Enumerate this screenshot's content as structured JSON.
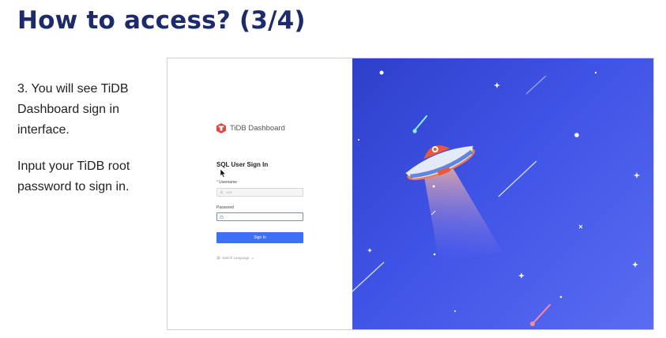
{
  "slide": {
    "title": "How to access? (3/4)",
    "step_text": "3. You will see TiDB Dashboard sign in interface.",
    "instruction_text": "Input your TiDB root password to sign in."
  },
  "login": {
    "brand_name": "TiDB Dashboard",
    "form_title": "SQL User Sign In",
    "username_label": "Username",
    "username_required_mark": "*",
    "username_value": "root",
    "password_label": "Password",
    "password_value": "",
    "sign_in_label": "Sign In",
    "language_switch_label": "Switch Language"
  },
  "icons": {
    "logo": "tidb-logo-icon",
    "username": "user-icon",
    "password": "lock-icon",
    "language": "globe-icon",
    "language_caret": "chevron-down-icon",
    "cursor": "mouse-cursor-icon"
  },
  "colors": {
    "title": "#1d2b6b",
    "primary_button": "#3d6ff7",
    "art_background_start": "#2e3fc9",
    "art_background_end": "#5a6cf1",
    "logo_red": "#e0483c",
    "ufo_body": "#dfe6f3",
    "ufo_dome": "#e85a3d"
  }
}
